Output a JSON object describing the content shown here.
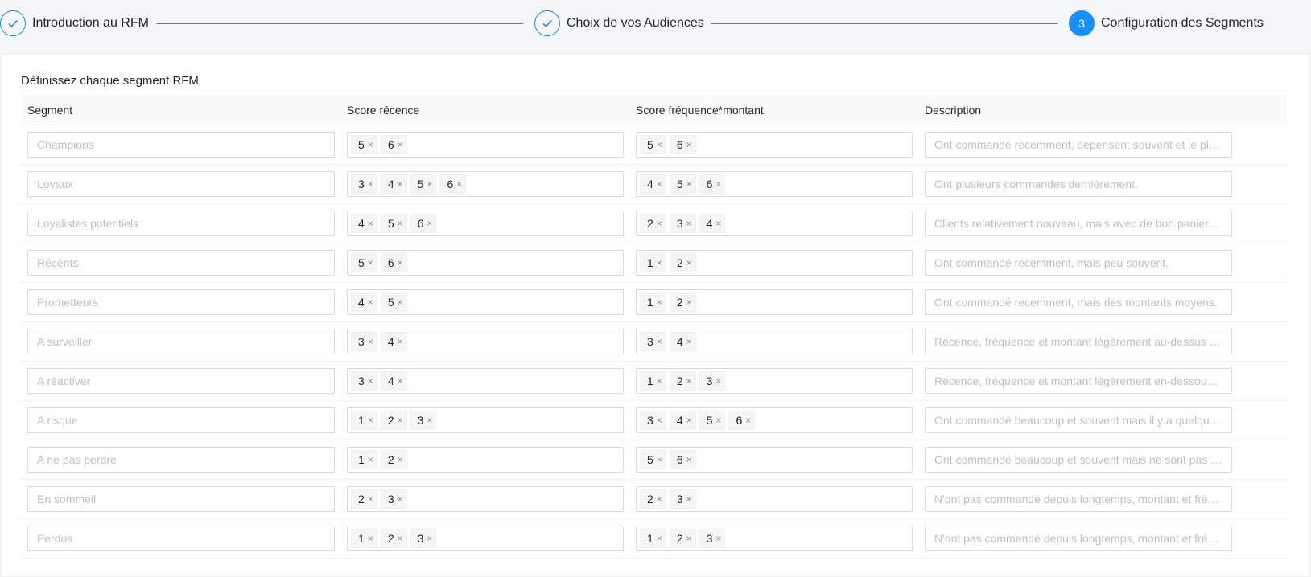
{
  "steps": [
    {
      "status": "done",
      "icon": "check-icon",
      "title": "Introduction au RFM"
    },
    {
      "status": "done",
      "icon": "check-icon",
      "title": "Choix de vos Audiences"
    },
    {
      "status": "active",
      "number": "3",
      "title": "Configuration des Segments"
    }
  ],
  "accent_color": "#1890ff",
  "card_title": "Définissez chaque segment RFM",
  "columns": [
    "Segment",
    "Score récence",
    "Score fréquence*montant",
    "Description"
  ],
  "tag_remove_glyph": "×",
  "rows": [
    {
      "segment": "Champions",
      "recence": [
        "5",
        "6"
      ],
      "frequence": [
        "5",
        "6"
      ],
      "description": "Ont commandé récemment, dépensent souvent et le plus."
    },
    {
      "segment": "Loyaux",
      "recence": [
        "3",
        "4",
        "5",
        "6"
      ],
      "frequence": [
        "4",
        "5",
        "6"
      ],
      "description": "Ont plusieurs commandes dernièrement."
    },
    {
      "segment": "Loyalistes potentiels",
      "recence": [
        "4",
        "5",
        "6"
      ],
      "frequence": [
        "2",
        "3",
        "4"
      ],
      "description": "Clients relativement nouveau, mais avec de bon paniers ..."
    },
    {
      "segment": "Récents",
      "recence": [
        "5",
        "6"
      ],
      "frequence": [
        "1",
        "2"
      ],
      "description": "Ont commandé recemment, mais peu souvent."
    },
    {
      "segment": "Prometteurs",
      "recence": [
        "4",
        "5"
      ],
      "frequence": [
        "1",
        "2"
      ],
      "description": "Ont commandé recemment, mais des montants moyens."
    },
    {
      "segment": "A surveiller",
      "recence": [
        "3",
        "4"
      ],
      "frequence": [
        "3",
        "4"
      ],
      "description": "Récence, fréquence et montant légèrement au-dessus de..."
    },
    {
      "segment": "A réactiver",
      "recence": [
        "3",
        "4"
      ],
      "frequence": [
        "1",
        "2",
        "3"
      ],
      "description": "Récence, fréquence et montant légèrement en-dessous d..."
    },
    {
      "segment": "A risque",
      "recence": [
        "1",
        "2",
        "3"
      ],
      "frequence": [
        "3",
        "4",
        "5",
        "6"
      ],
      "description": "Ont commandé beaucoup et souvent mais il y a quelque t..."
    },
    {
      "segment": "A ne pas perdre",
      "recence": [
        "1",
        "2"
      ],
      "frequence": [
        "5",
        "6"
      ],
      "description": "Ont commandé beaucoup et souvent mais ne sont pas re..."
    },
    {
      "segment": "En sommeil",
      "recence": [
        "2",
        "3"
      ],
      "frequence": [
        "2",
        "3"
      ],
      "description": "N'ont pas commandé depuis longtemps, montant et fréqu..."
    },
    {
      "segment": "Perdus",
      "recence": [
        "1",
        "2",
        "3"
      ],
      "frequence": [
        "1",
        "2",
        "3"
      ],
      "description": "N'ont pas commandé depuis longtemps, montant et fréqu..."
    }
  ]
}
